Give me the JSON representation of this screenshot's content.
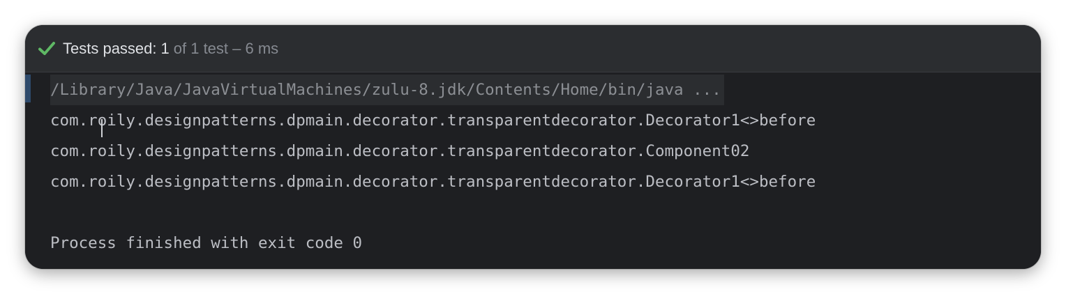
{
  "test_status": {
    "label": "Tests passed:",
    "passed": "1",
    "summary": "of 1 test – 6 ms",
    "icon": "check-icon",
    "icon_color": "#5fb865"
  },
  "console": {
    "command": "/Library/Java/JavaVirtualMachines/zulu-8.jdk/Contents/Home/bin/java ...",
    "output_lines": [
      "com.roily.designpatterns.dpmain.decorator.transparentdecorator.Decorator1<>before",
      "com.roily.designpatterns.dpmain.decorator.transparentdecorator.Component02",
      "com.roily.designpatterns.dpmain.decorator.transparentdecorator.Decorator1<>before"
    ],
    "exit_message": "Process finished with exit code 0"
  }
}
